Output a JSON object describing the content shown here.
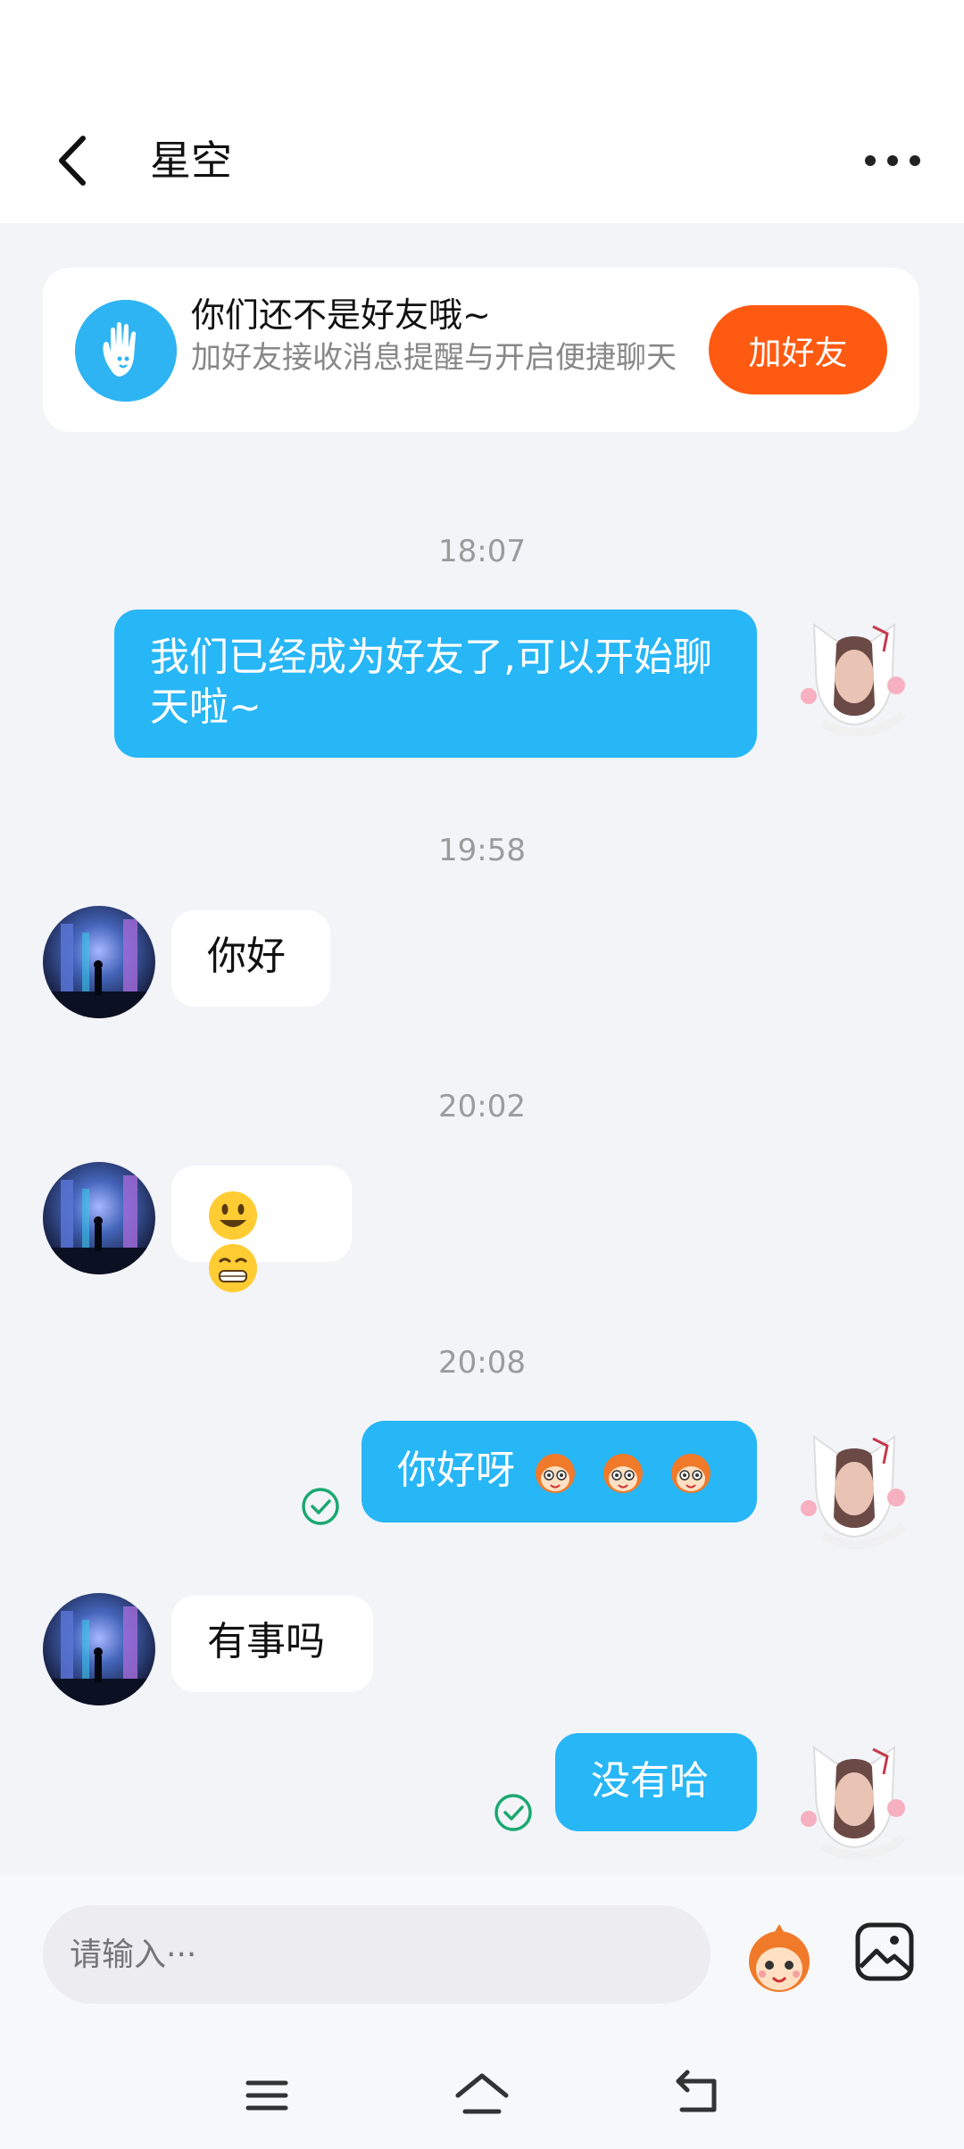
{
  "header": {
    "title": "星空"
  },
  "friend_card": {
    "title": "你们还不是好友哦~",
    "subtitle": "加好友接收消息提醒与开启便捷聊天",
    "button_label": "加好友"
  },
  "messages": [
    {
      "time": "18:07"
    },
    {
      "text": "我们已经成为好友了,可以开始聊天啦~"
    },
    {
      "time": "19:58"
    },
    {
      "text": "你好"
    },
    {
      "time": "20:02"
    },
    {
      "time": "20:08"
    },
    {
      "text": "你好呀"
    },
    {
      "text": "有事吗"
    },
    {
      "text": "没有哈"
    }
  ],
  "input": {
    "placeholder": "请输入···"
  },
  "colors": {
    "accent_blue": "#27b6f6",
    "add_button": "#ff5a12",
    "read_check": "#1aa870"
  },
  "icons": [
    "back-arrow-icon",
    "more-icon",
    "hand-wave-icon",
    "read-check-icon",
    "mascot-emoji-icon",
    "image-icon",
    "menu-icon",
    "home-icon",
    "return-icon"
  ]
}
